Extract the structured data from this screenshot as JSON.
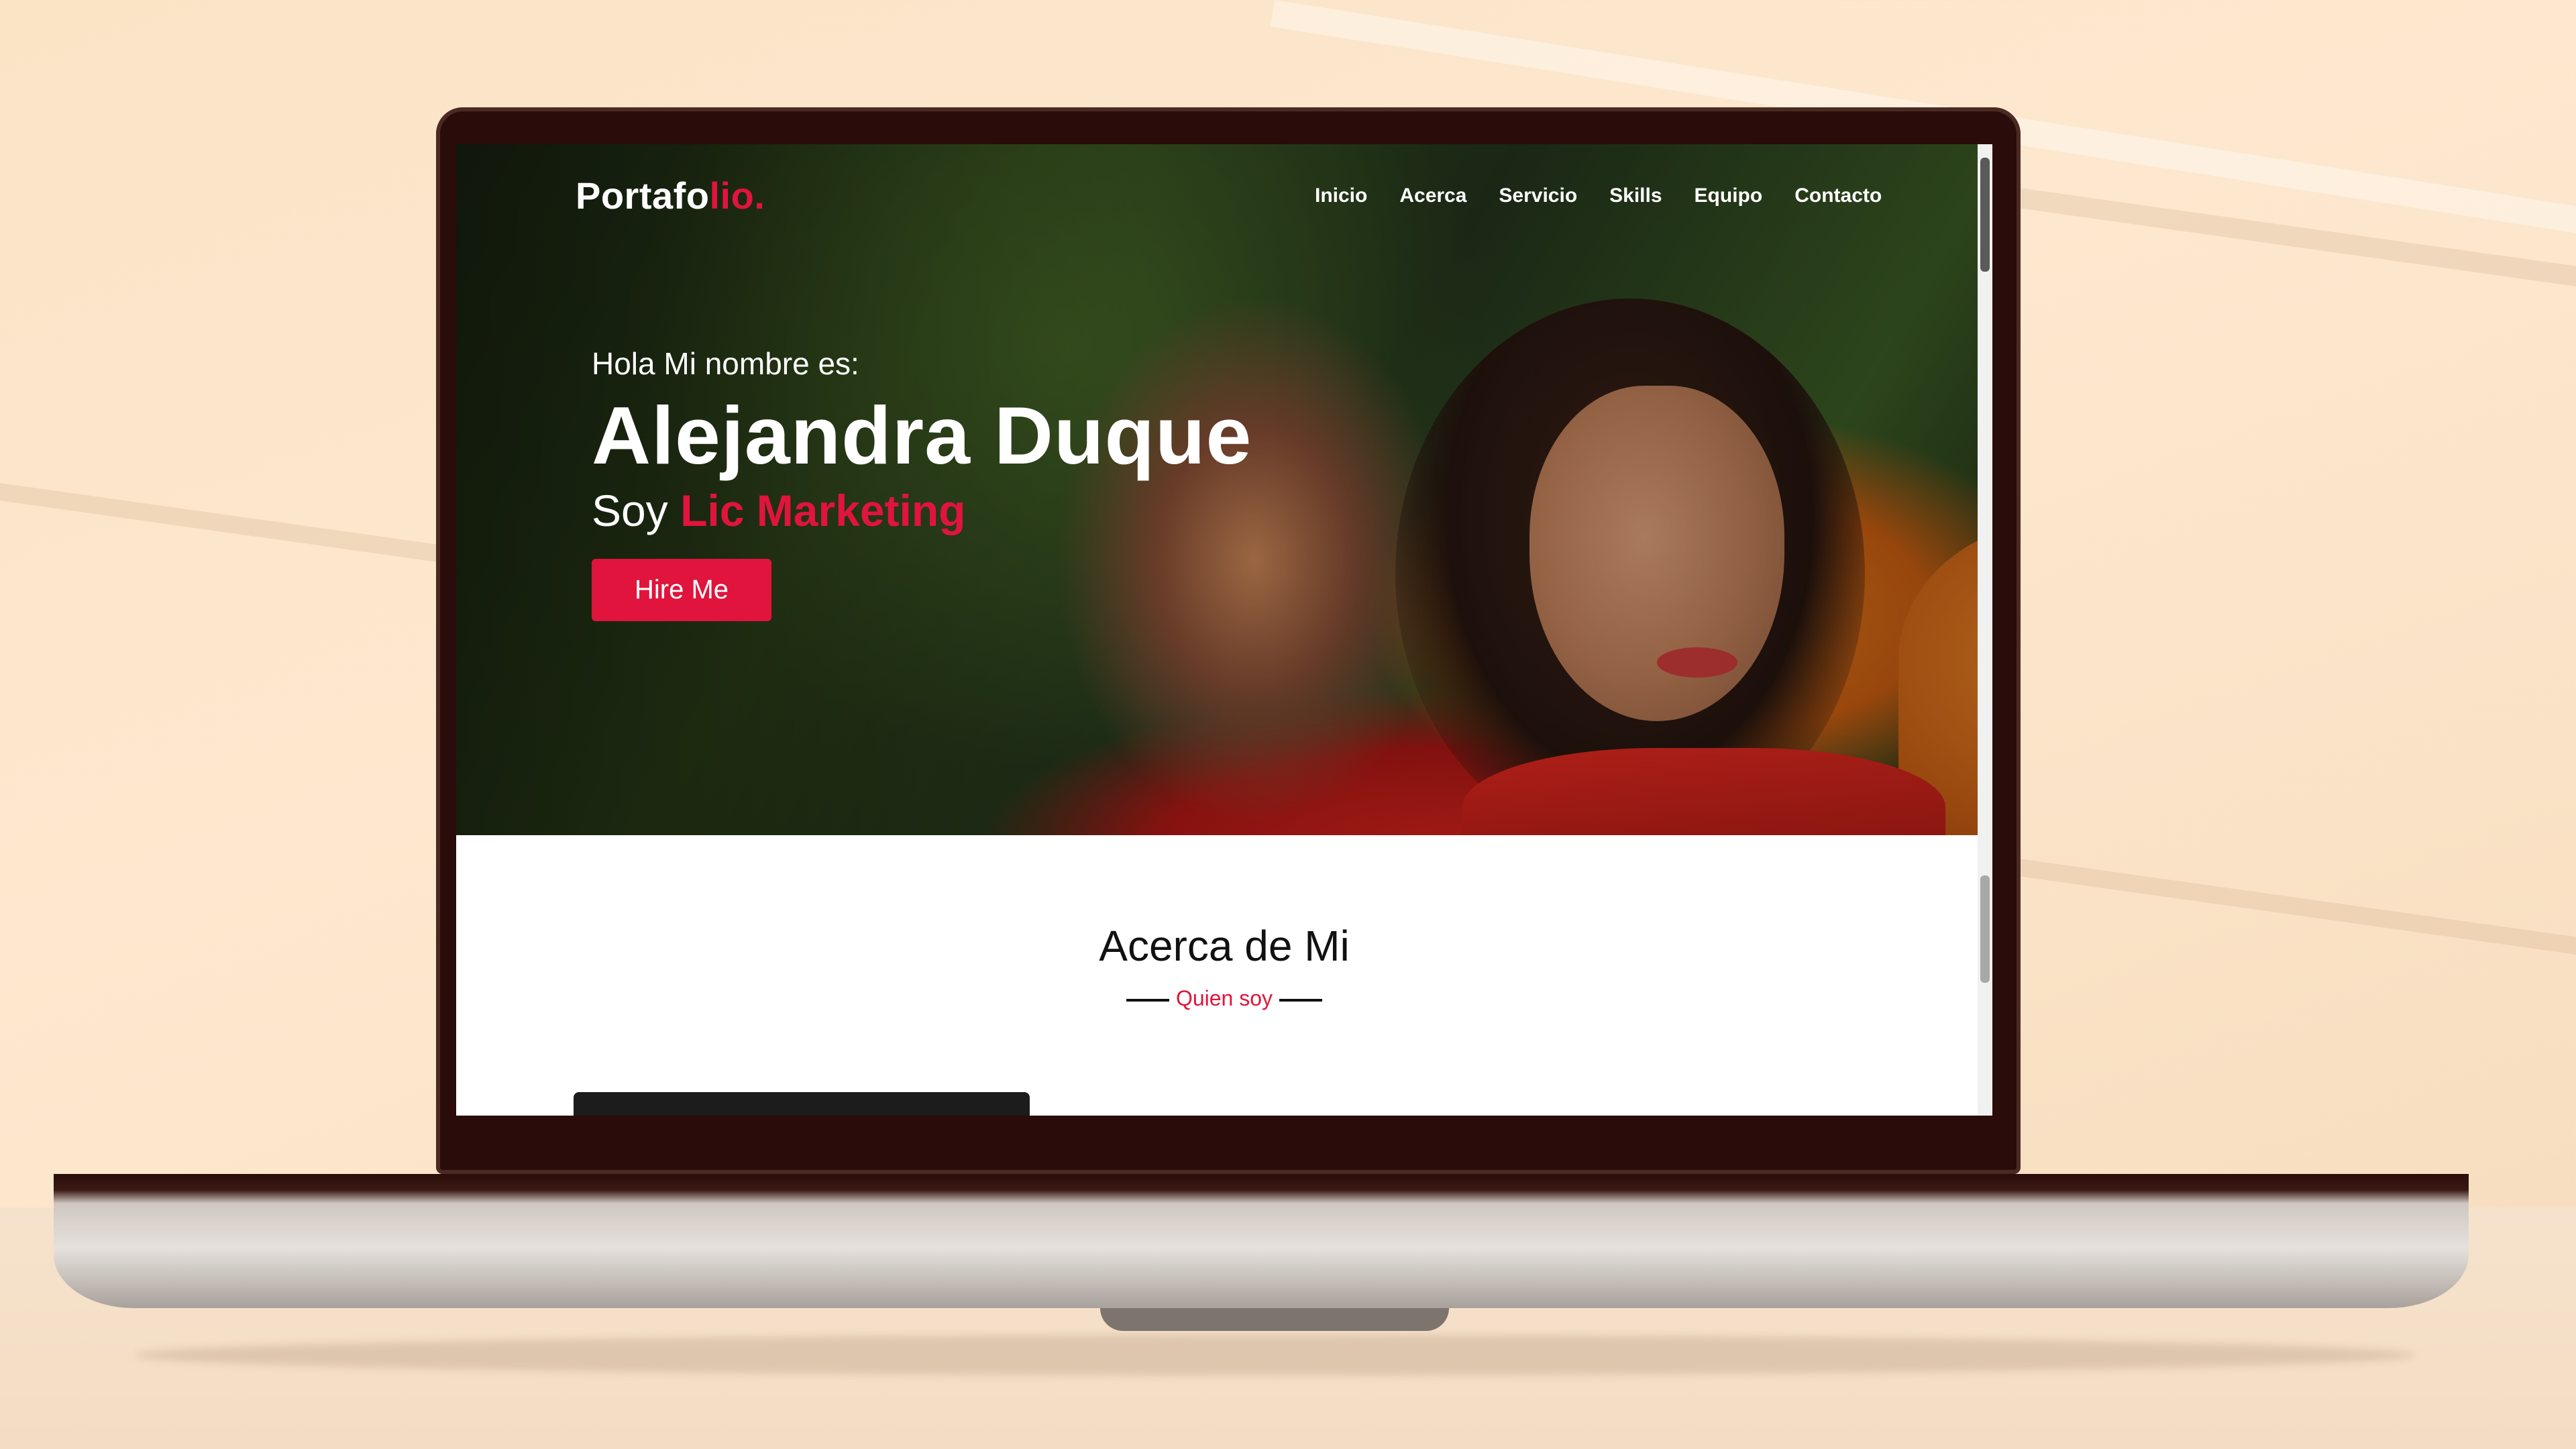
{
  "nav": {
    "logo_main": "Portafo",
    "logo_accent": "lio.",
    "items": [
      "Inicio",
      "Acerca",
      "Servicio",
      "Skills",
      "Equipo",
      "Contacto"
    ]
  },
  "hero": {
    "greeting": "Hola Mi nombre es:",
    "name": "Alejandra Duque",
    "role_prefix": "Soy",
    "role_highlight": "Lic Marketing",
    "cta_label": "Hire Me"
  },
  "about": {
    "title": "Acerca de Mi",
    "subtitle": "Quien soy"
  },
  "colors": {
    "accent": "#e0143c",
    "text_dark": "#111111",
    "text_light": "#ffffff"
  }
}
